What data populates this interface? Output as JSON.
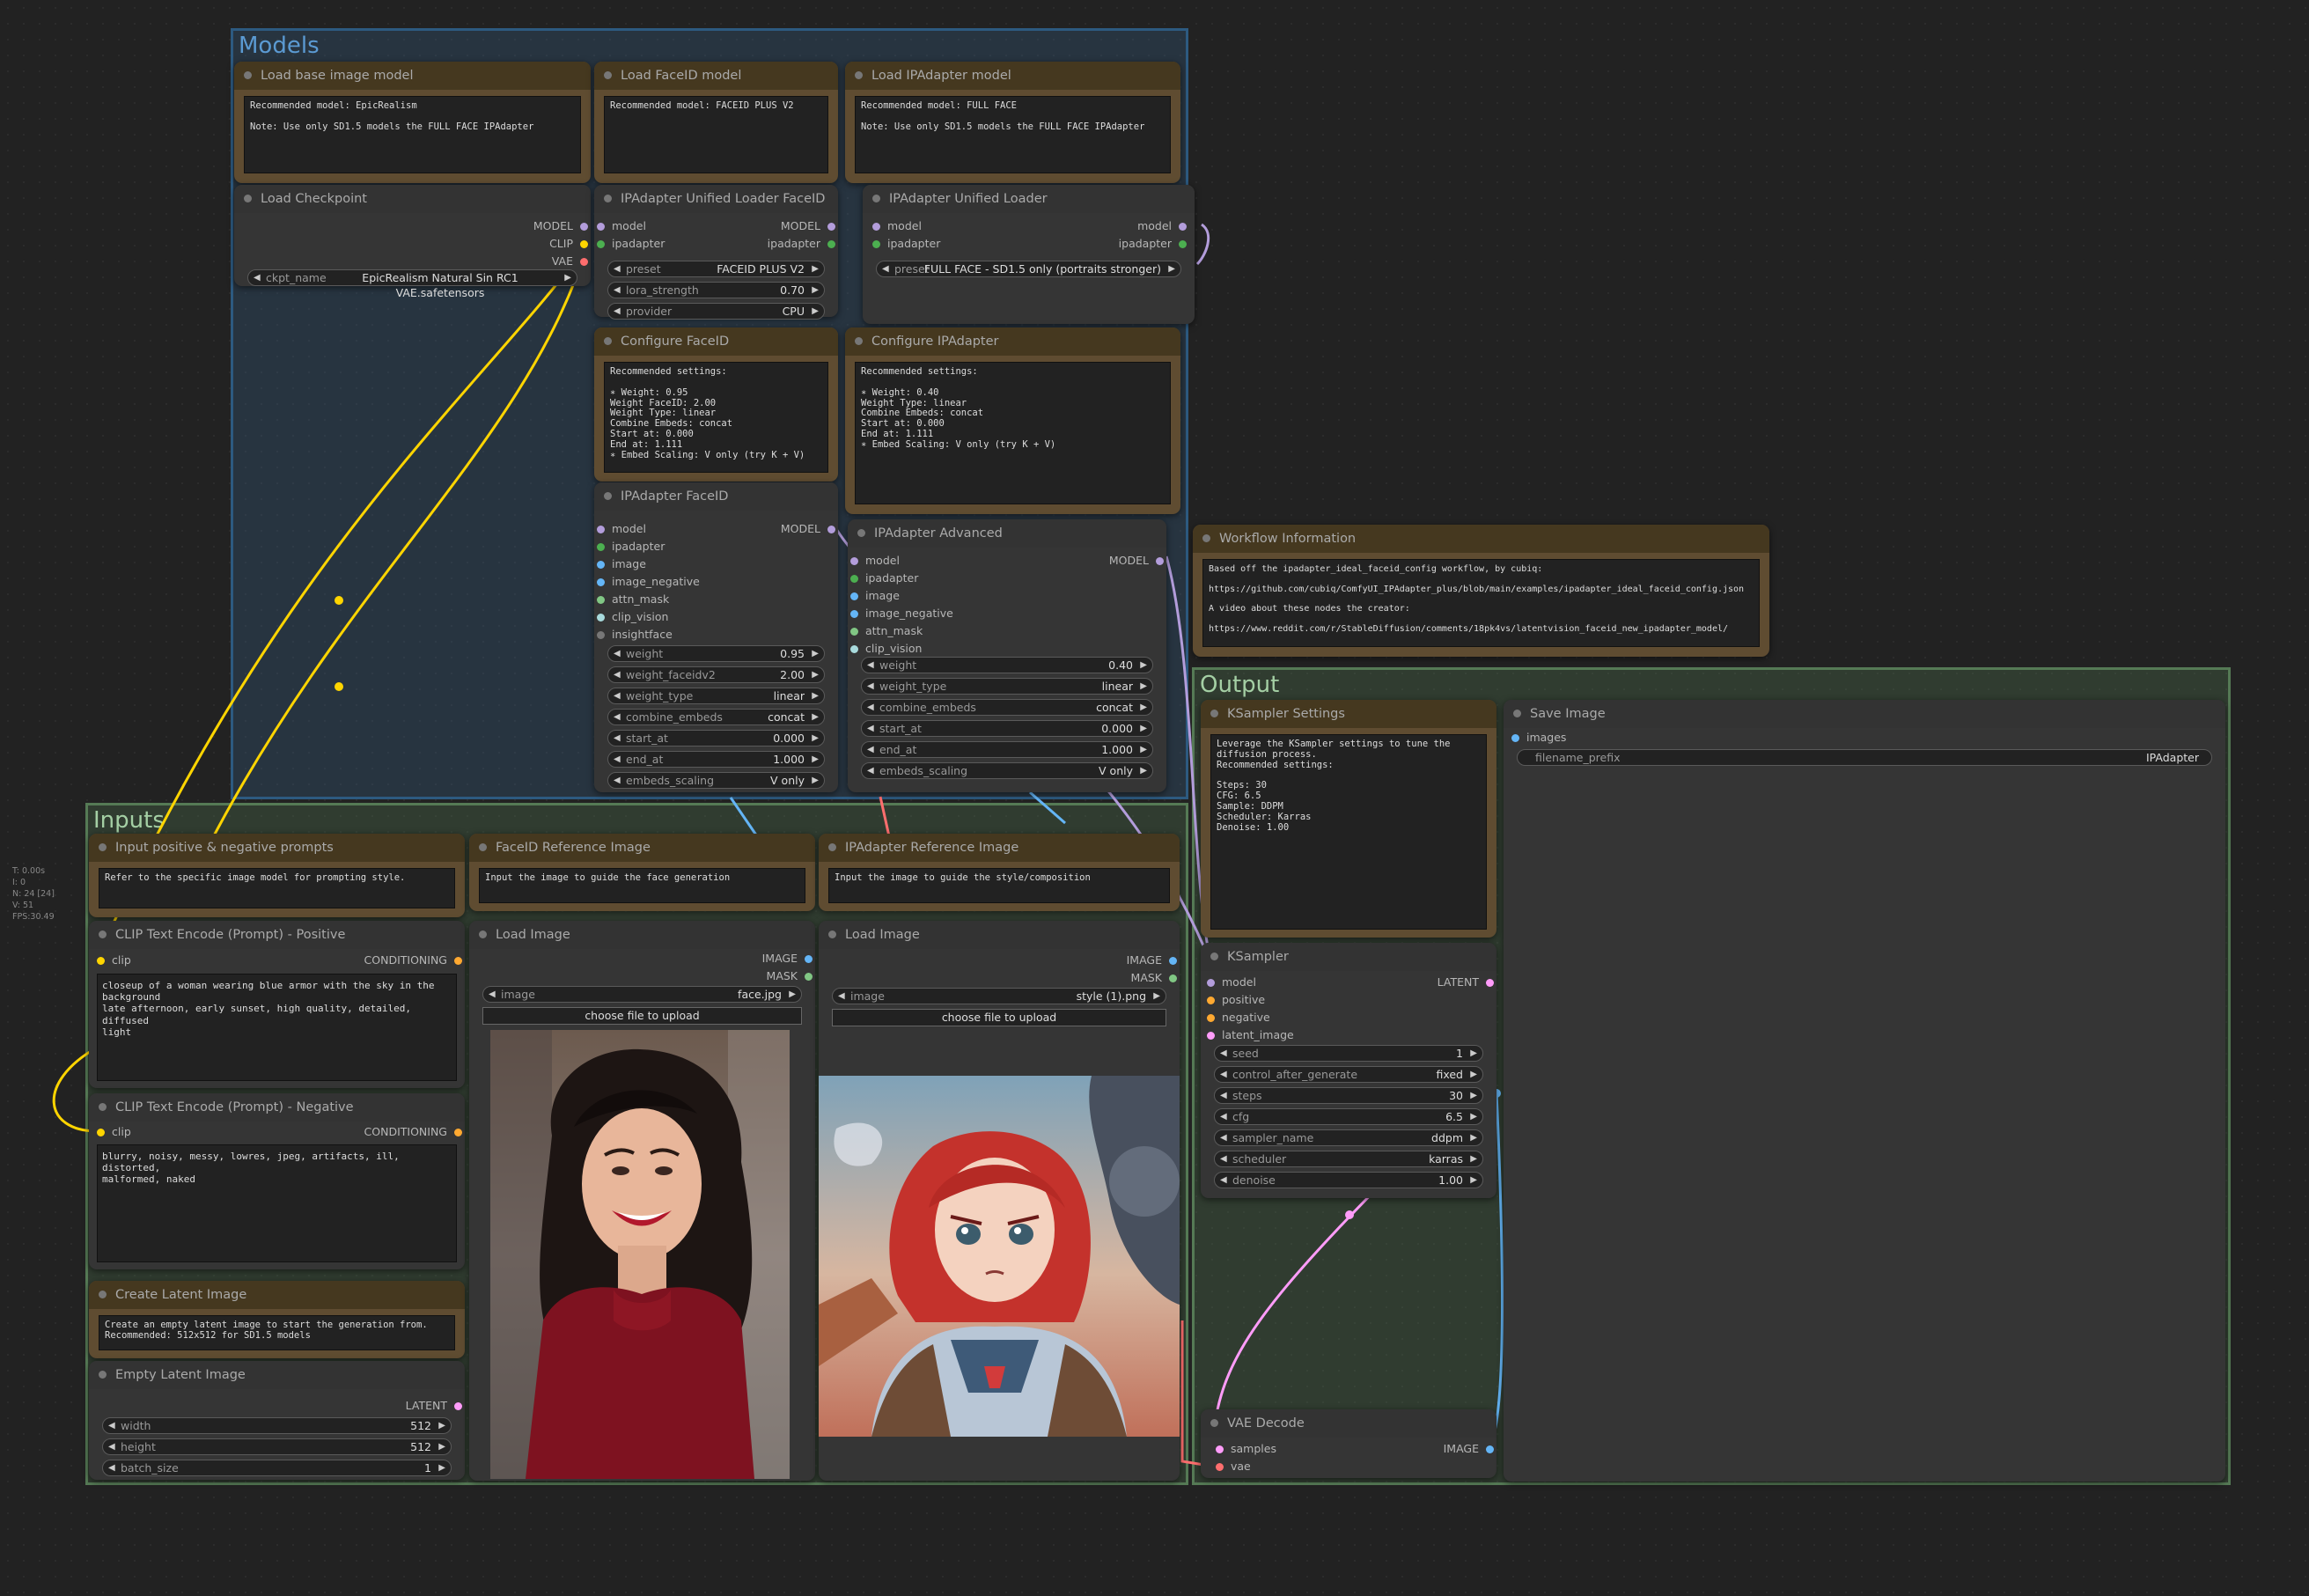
{
  "colors": {
    "model": "#b39ddb",
    "clip": "#ffd500",
    "vae": "#ff6e6e",
    "ipadapter": "#4caf50",
    "image": "#64b5f6",
    "mask": "#81c784",
    "conditioning": "#ffa931",
    "latent": "#ff9cf9",
    "insightface": "#777777",
    "attn_mask": "#4caf50",
    "clip_vision": "#a8dadc"
  },
  "groups": {
    "models": "Models",
    "inputs": "Inputs",
    "output": "Output"
  },
  "stats": "T: 0.00s\nI: 0\nN: 24 [24]\nV: 51\nFPS:30.49",
  "notes": {
    "base_model": {
      "title": "Load base image model",
      "text": "Recommended model: EpicRealism\n\nNote: Use only SD1.5 models the FULL FACE IPAdapter"
    },
    "faceid_model": {
      "title": "Load FaceID model",
      "text": "Recommended model: FACEID PLUS V2"
    },
    "ipa_model": {
      "title": "Load IPAdapter model",
      "text": "Recommended model: FULL FACE\n\nNote: Use only SD1.5 models the FULL FACE IPAdapter"
    },
    "cfg_faceid": {
      "title": "Configure FaceID",
      "text": "Recommended settings:\n\n∗ Weight: 0.95\nWeight FaceID: 2.00\nWeight Type: linear\nCombine Embeds: concat\nStart at: 0.000\nEnd at: 1.111\n∗ Embed Scaling: V only (try K + V)"
    },
    "cfg_ipa": {
      "title": "Configure IPAdapter",
      "text": "Recommended settings:\n\n∗ Weight: 0.40\nWeight Type: linear\nCombine Embeds: concat\nStart at: 0.000\nEnd at: 1.111\n∗ Embed Scaling: V only (try K + V)"
    },
    "workflow": {
      "title": "Workflow Information",
      "text": "Based off the ipadapter_ideal_faceid_config workflow, by cubiq:\n\nhttps://github.com/cubiq/ComfyUI_IPAdapter_plus/blob/main/examples/ipadapter_ideal_faceid_config.json\n\nA video about these nodes the creator:\n\nhttps://www.reddit.com/r/StableDiffusion/comments/18pk4vs/latentvision_faceid_new_ipadapter_model/"
    },
    "prompts": {
      "title": "Input positive & negative prompts",
      "text": "Refer to the specific image model for prompting style."
    },
    "faceid_ref": {
      "title": "FaceID Reference Image",
      "text": "Input the image to guide the face generation"
    },
    "ipa_ref": {
      "title": "IPAdapter Reference Image",
      "text": "Input the image to guide the style/composition"
    },
    "latent": {
      "title": "Create Latent Image",
      "text": "Create an empty latent image to start the generation from.\nRecommended: 512x512 for SD1.5 models"
    },
    "ksampler_settings": {
      "title": "KSampler Settings",
      "text": "Leverage the KSampler settings to tune the\ndiffusion process.\nRecommended settings:\n\nSteps: 30\nCFG: 6.5\nSample: DDPM\nScheduler: Karras\nDenoise: 1.00"
    }
  },
  "checkpoint": {
    "title": "Load Checkpoint",
    "outputs": [
      "MODEL",
      "CLIP",
      "VAE"
    ],
    "ckpt_label": "ckpt_name",
    "ckpt_value": "EpicRealism Natural Sin RC1 VAE.safetensors"
  },
  "loader_faceid": {
    "title": "IPAdapter Unified Loader FaceID",
    "in_model": "model",
    "in_ipadapter": "ipadapter",
    "out_model": "MODEL",
    "out_ipadapter": "ipadapter",
    "widgets": [
      {
        "label": "preset",
        "value": "FACEID PLUS V2"
      },
      {
        "label": "lora_strength",
        "value": "0.70"
      },
      {
        "label": "provider",
        "value": "CPU"
      }
    ]
  },
  "loader_ipa": {
    "title": "IPAdapter Unified Loader",
    "in_model": "model",
    "in_ipadapter": "ipadapter",
    "out_model": "model",
    "out_ipadapter": "ipadapter",
    "widgets": [
      {
        "label": "preset",
        "value": "FULL FACE - SD1.5 only (portraits stronger)"
      }
    ]
  },
  "ipa_faceid": {
    "title": "IPAdapter FaceID",
    "out": "MODEL",
    "inputs": [
      "model",
      "ipadapter",
      "image",
      "image_negative",
      "attn_mask",
      "clip_vision",
      "insightface"
    ],
    "widgets": [
      {
        "label": "weight",
        "value": "0.95"
      },
      {
        "label": "weight_faceidv2",
        "value": "2.00"
      },
      {
        "label": "weight_type",
        "value": "linear"
      },
      {
        "label": "combine_embeds",
        "value": "concat"
      },
      {
        "label": "start_at",
        "value": "0.000"
      },
      {
        "label": "end_at",
        "value": "1.000"
      },
      {
        "label": "embeds_scaling",
        "value": "V only"
      }
    ]
  },
  "ipa_adv": {
    "title": "IPAdapter Advanced",
    "out": "MODEL",
    "inputs": [
      "model",
      "ipadapter",
      "image",
      "image_negative",
      "attn_mask",
      "clip_vision"
    ],
    "widgets": [
      {
        "label": "weight",
        "value": "0.40"
      },
      {
        "label": "weight_type",
        "value": "linear"
      },
      {
        "label": "combine_embeds",
        "value": "concat"
      },
      {
        "label": "start_at",
        "value": "0.000"
      },
      {
        "label": "end_at",
        "value": "1.000"
      },
      {
        "label": "embeds_scaling",
        "value": "V only"
      }
    ]
  },
  "clip_pos": {
    "title": "CLIP Text Encode (Prompt) - Positive",
    "in": "clip",
    "out": "CONDITIONING",
    "text": "closeup of a woman wearing blue armor with the sky in the\nbackground\nlate afternoon, early sunset, high quality, detailed, diffused\nlight"
  },
  "clip_neg": {
    "title": "CLIP Text Encode (Prompt) - Negative",
    "in": "clip",
    "out": "CONDITIONING",
    "text": "blurry, noisy, messy, lowres, jpeg, artifacts, ill, distorted,\nmalformed, naked"
  },
  "empty_latent": {
    "title": "Empty Latent Image",
    "out": "LATENT",
    "widgets": [
      {
        "label": "width",
        "value": "512"
      },
      {
        "label": "height",
        "value": "512"
      },
      {
        "label": "batch_size",
        "value": "1"
      }
    ]
  },
  "load_face": {
    "title": "Load Image",
    "out_image": "IMAGE",
    "out_mask": "MASK",
    "image_label": "image",
    "image_value": "face.jpg",
    "upload": "choose file to upload"
  },
  "load_style": {
    "title": "Load Image",
    "out_image": "IMAGE",
    "out_mask": "MASK",
    "image_label": "image",
    "image_value": "style (1).png",
    "upload": "choose file to upload"
  },
  "ksampler": {
    "title": "KSampler",
    "out": "LATENT",
    "inputs": [
      "model",
      "positive",
      "negative",
      "latent_image"
    ],
    "widgets": [
      {
        "label": "seed",
        "value": "1"
      },
      {
        "label": "control_after_generate",
        "value": "fixed"
      },
      {
        "label": "steps",
        "value": "30"
      },
      {
        "label": "cfg",
        "value": "6.5"
      },
      {
        "label": "sampler_name",
        "value": "ddpm"
      },
      {
        "label": "scheduler",
        "value": "karras"
      },
      {
        "label": "denoise",
        "value": "1.00"
      }
    ]
  },
  "save_image": {
    "title": "Save Image",
    "in": "images",
    "prefix_label": "filename_prefix",
    "prefix_value": "IPAdapter"
  },
  "vae_decode": {
    "title": "VAE Decode",
    "in_samples": "samples",
    "in_vae": "vae",
    "out": "IMAGE"
  }
}
